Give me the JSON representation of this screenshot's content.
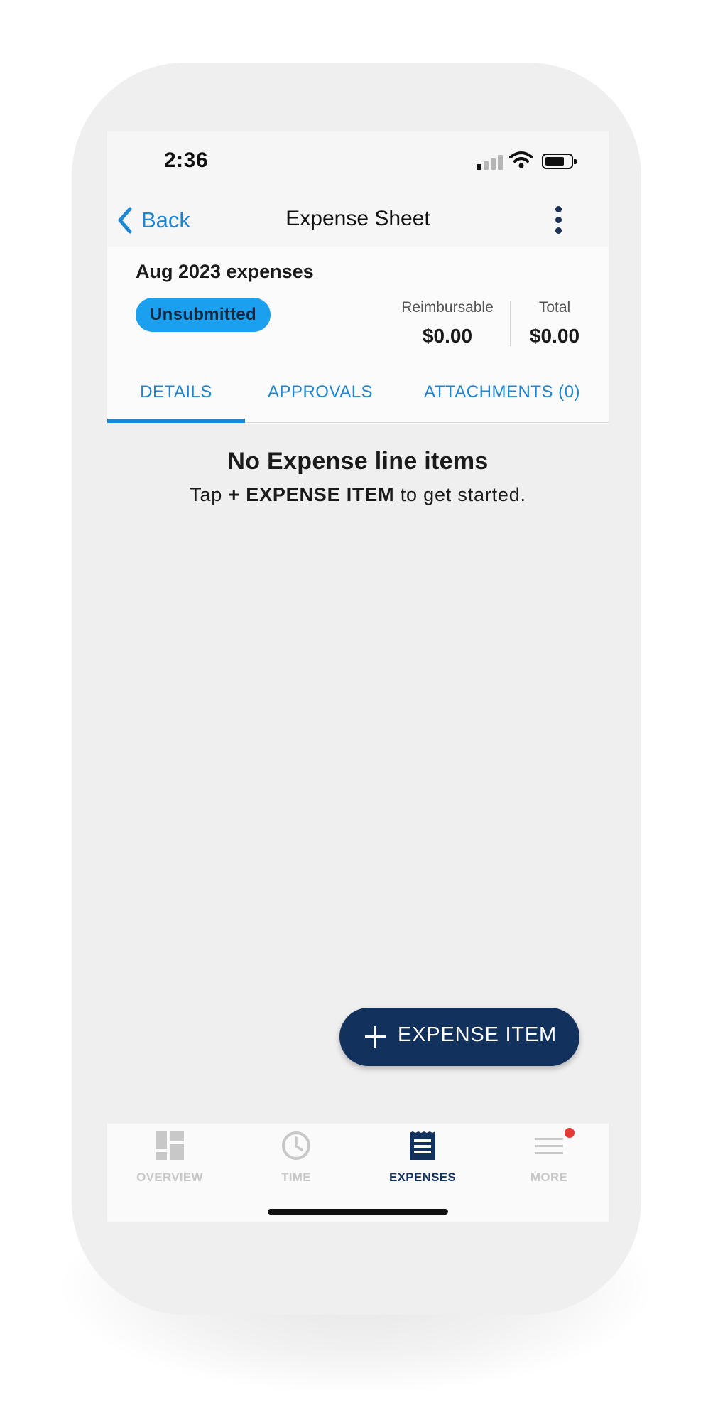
{
  "status_bar": {
    "time": "2:36"
  },
  "nav": {
    "back_label": "Back",
    "title": "Expense Sheet"
  },
  "sheet": {
    "title": "Aug 2023 expenses",
    "status": "Unsubmitted",
    "reimbursable_label": "Reimbursable",
    "reimbursable_value": "$0.00",
    "total_label": "Total",
    "total_value": "$0.00"
  },
  "tabs": [
    {
      "label": "DETAILS",
      "selected": true
    },
    {
      "label": "APPROVALS",
      "selected": false
    },
    {
      "label": "ATTACHMENTS (0)",
      "selected": false
    }
  ],
  "empty_state": {
    "title": "No Expense line items",
    "hint_prefix": "Tap",
    "hint_action": "+ EXPENSE ITEM",
    "hint_suffix": "to get started."
  },
  "fab": {
    "label": "EXPENSE ITEM",
    "icon": "plus-icon"
  },
  "bottom_nav": {
    "items": [
      {
        "label": "OVERVIEW",
        "icon": "dashboard-icon",
        "active": false
      },
      {
        "label": "TIME",
        "icon": "clock-icon",
        "active": false
      },
      {
        "label": "EXPENSES",
        "icon": "receipt-icon",
        "active": true
      },
      {
        "label": "MORE",
        "icon": "menu-icon",
        "active": false,
        "has_notification": true
      }
    ]
  },
  "colors": {
    "accent": "#1d86d2",
    "badge": "#1aa0ef",
    "navy": "#13315d",
    "notification": "#e53935"
  }
}
